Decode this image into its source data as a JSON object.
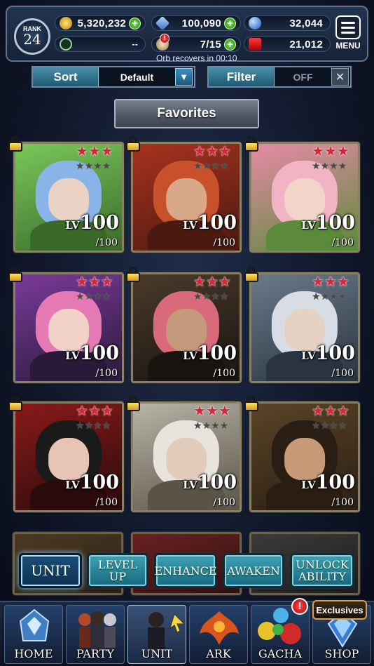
{
  "header": {
    "rank_label": "RANK",
    "rank_value": "24",
    "gold": "5,320,232",
    "crystals": "100,090",
    "blue_currency": "32,044",
    "slot_value": "--",
    "orbs": "7/15",
    "red_currency": "21,012",
    "orb_recover_text": "Orb recovers in 00:10",
    "menu_label": "MENU"
  },
  "controls": {
    "sort_label": "Sort",
    "sort_value": "Default",
    "filter_label": "Filter",
    "filter_value": "OFF",
    "favorites_label": "Favorites"
  },
  "units": [
    {
      "lv_label": "LV",
      "level": "100",
      "cap": "/100",
      "stars": 3
    },
    {
      "lv_label": "LV",
      "level": "100",
      "cap": "/100",
      "stars": 3
    },
    {
      "lv_label": "LV",
      "level": "100",
      "cap": "/100",
      "stars": 3
    },
    {
      "lv_label": "LV",
      "level": "100",
      "cap": "/100",
      "stars": 3
    },
    {
      "lv_label": "LV",
      "level": "100",
      "cap": "/100",
      "stars": 3
    },
    {
      "lv_label": "LV",
      "level": "100",
      "cap": "/100",
      "stars": 3
    },
    {
      "lv_label": "LV",
      "level": "100",
      "cap": "/100",
      "stars": 3
    },
    {
      "lv_label": "LV",
      "level": "100",
      "cap": "/100",
      "stars": 3
    },
    {
      "lv_label": "LV",
      "level": "100",
      "cap": "/100",
      "stars": 3
    }
  ],
  "subtabs": {
    "unit": "UNIT",
    "level_up": "LEVEL UP",
    "enhance": "ENHANCE",
    "awaken": "AWAKEN",
    "unlock_ability": "UNLOCK ABILITY"
  },
  "nav": {
    "home": "HOME",
    "party": "PARTY",
    "unit": "UNIT",
    "ark": "ARK",
    "gacha": "GACHA",
    "shop": "SHOP",
    "exclusives": "Exclusives",
    "badge": "!"
  },
  "colors": {
    "accent_teal": "#3fa2b6",
    "star_red": "#d9263a",
    "gold_frame": "#8a8064"
  }
}
